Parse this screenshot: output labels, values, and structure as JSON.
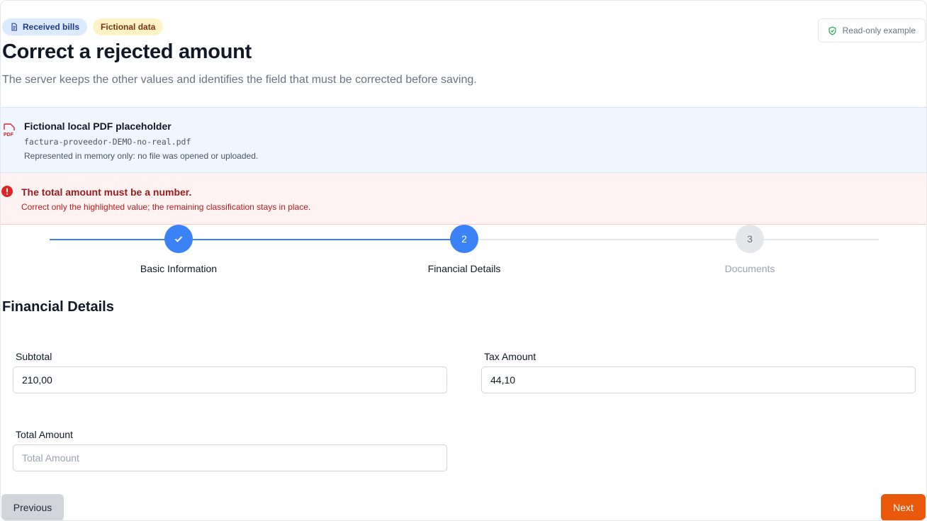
{
  "header": {
    "badges": [
      {
        "label": "Received bills",
        "icon": "document-icon",
        "color": "#dbeafe"
      },
      {
        "label": "Fictional data",
        "color": "#fef3c7"
      }
    ],
    "readonly_label": "Read-only example",
    "title": "Correct a rejected amount",
    "subtitle": "The server keeps the other values and identifies the field that must be corrected before saving."
  },
  "pdf_notice": {
    "icon": "pdf-icon",
    "title": "Fictional local PDF placeholder",
    "filename": "factura-proveedor-DEMO-no-real.pdf",
    "note": "Represented in memory only: no file was opened or uploaded."
  },
  "error_notice": {
    "icon": "alert-circle-icon",
    "title": "The total amount must be a number.",
    "text": "Correct only the highlighted value; the remaining classification stays in place."
  },
  "stepper": {
    "active_color": "#3b82f6",
    "steps": [
      {
        "number": "1",
        "label": "Basic Information",
        "state": "complete"
      },
      {
        "number": "2",
        "label": "Financial Details",
        "state": "current"
      },
      {
        "number": "3",
        "label": "Documents",
        "state": "upcoming"
      }
    ]
  },
  "form": {
    "section_title": "Financial Details",
    "subtotal": {
      "label": "Subtotal",
      "value": "210,00"
    },
    "tax": {
      "label": "Tax Amount",
      "value": "44,10"
    },
    "total": {
      "label": "Total Amount",
      "value": "",
      "placeholder": "Total Amount"
    }
  },
  "actions": {
    "previous_label": "Previous",
    "next_label": "Next",
    "next_color": "#ea580c"
  }
}
